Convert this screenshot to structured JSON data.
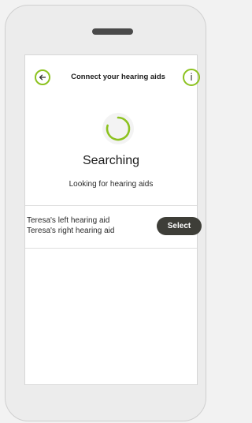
{
  "header": {
    "title": "Connect your hearing aids",
    "back_icon": "arrow-left-icon",
    "info_icon": "info-icon",
    "info_glyph": "i"
  },
  "status": {
    "title": "Searching",
    "subtitle": "Looking for hearing aids"
  },
  "device_pair": {
    "left_name": "Teresa's left hearing aid",
    "right_name": "Teresa's right hearing aid",
    "select_label": "Select"
  },
  "colors": {
    "accent": "#8cc21f",
    "button_dark": "#3e3e38",
    "text": "#1c1c1c"
  }
}
